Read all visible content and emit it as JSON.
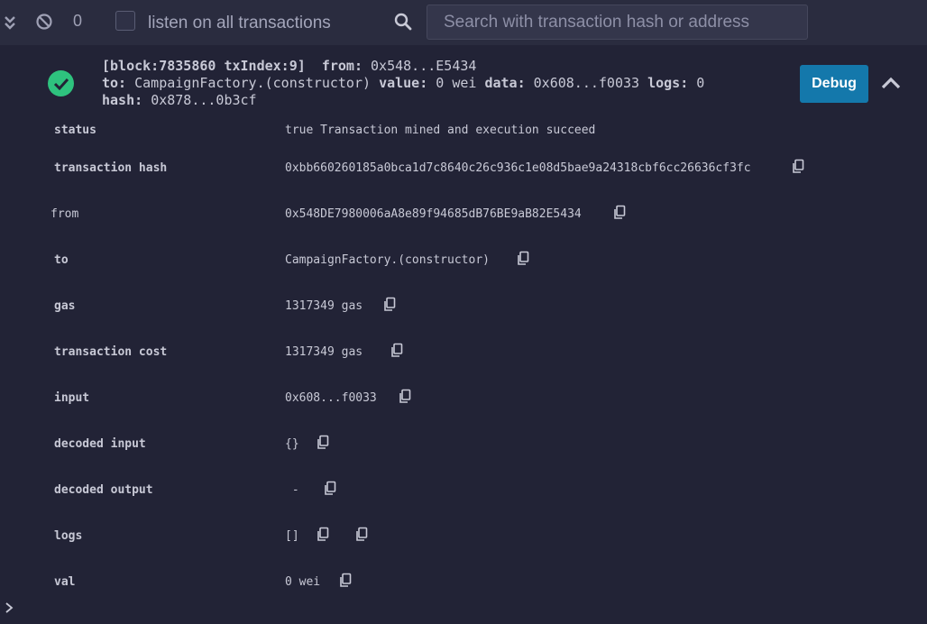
{
  "toolbar": {
    "count": "0",
    "listen_label": "listen on all transactions",
    "search_placeholder": "Search with transaction hash or address"
  },
  "tx": {
    "block_label": "[block:7835860 txIndex:9]",
    "from_label": "from:",
    "from_value": "0x548...E5434",
    "to_label": "to:",
    "to_value": "CampaignFactory.(constructor)",
    "value_label": "value:",
    "value_value": "0 wei",
    "data_label": "data:",
    "data_value": "0x608...f0033",
    "logs_label": "logs:",
    "logs_value": "0",
    "hash_label": "hash:",
    "hash_value": "0x878...0b3cf",
    "debug_label": "Debug"
  },
  "details": [
    {
      "key": "status",
      "value": "true Transaction mined and execution succeed"
    },
    {
      "key": "transaction hash",
      "value": "0xbb660260185a0bca1d7c8640c26c936c1e08d5bae9a24318cbf6cc26636cf3fc"
    },
    {
      "key": "from",
      "value": "0x548DE7980006aA8e89f94685dB76BE9aB82E5434"
    },
    {
      "key": "to",
      "value": "CampaignFactory.(constructor)"
    },
    {
      "key": "gas",
      "value": "1317349 gas"
    },
    {
      "key": "transaction cost",
      "value": "1317349 gas"
    },
    {
      "key": "input",
      "value": "0x608...f0033"
    },
    {
      "key": "decoded input",
      "value": "{}"
    },
    {
      "key": "decoded output",
      "value": " - "
    },
    {
      "key": "logs",
      "value": "[]"
    },
    {
      "key": "val",
      "value": "0 wei"
    }
  ]
}
